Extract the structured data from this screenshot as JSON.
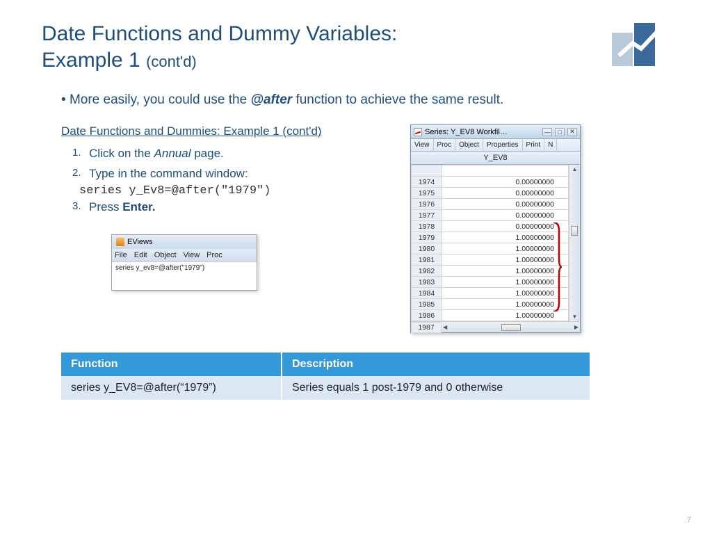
{
  "title": {
    "line1": "Date Functions and Dummy Variables:",
    "line2_main": "Example 1 ",
    "line2_sub": "(cont'd)"
  },
  "bullet": {
    "pre": "More easily, you could use the ",
    "func": "@after",
    "post": " function to achieve the same result."
  },
  "subtitle": "Date Functions and Dummies: Example 1 (cont'd)",
  "steps": [
    {
      "num": "1.",
      "pre": "Click on the ",
      "em": "Annual",
      "post": " page."
    },
    {
      "num": "2.",
      "pre": "Type in the command window:",
      "em": "",
      "post": ""
    },
    {
      "num": "3.",
      "pre": " Press ",
      "bold": "Enter.",
      "post": ""
    }
  ],
  "code_line": "series y_Ev8=@after(\"1979\")",
  "ev_main": {
    "title": "EViews",
    "menus": [
      "File",
      "Edit",
      "Object",
      "View",
      "Proc"
    ],
    "cmd": "series y_ev8=@after(\"1979\")"
  },
  "ev_series": {
    "title": "Series: Y_EV8   Workfil…",
    "toolbar": [
      "View",
      "Proc",
      "Object",
      "Properties",
      "Print",
      "N"
    ],
    "head": "Y_EV8",
    "rows": [
      {
        "yr": "",
        "val": ""
      },
      {
        "yr": "1974",
        "val": "0.00000000"
      },
      {
        "yr": "1975",
        "val": "0.00000000"
      },
      {
        "yr": "1976",
        "val": "0.00000000"
      },
      {
        "yr": "1977",
        "val": "0.00000000"
      },
      {
        "yr": "1978",
        "val": "0.00000000"
      },
      {
        "yr": "1979",
        "val": "1.00000000"
      },
      {
        "yr": "1980",
        "val": "1.00000000"
      },
      {
        "yr": "1981",
        "val": "1.00000000"
      },
      {
        "yr": "1982",
        "val": "1.00000000"
      },
      {
        "yr": "1983",
        "val": "1.00000000"
      },
      {
        "yr": "1984",
        "val": "1.00000000"
      },
      {
        "yr": "1985",
        "val": "1.00000000"
      },
      {
        "yr": "1986",
        "val": "1.00000000"
      }
    ],
    "last_yr": "1987"
  },
  "ftable": {
    "headers": [
      "Function",
      "Description"
    ],
    "row": [
      "series y_EV8=@after(“1979”)",
      "Series equals 1 post-1979 and 0 otherwise"
    ]
  },
  "page_number": "7"
}
